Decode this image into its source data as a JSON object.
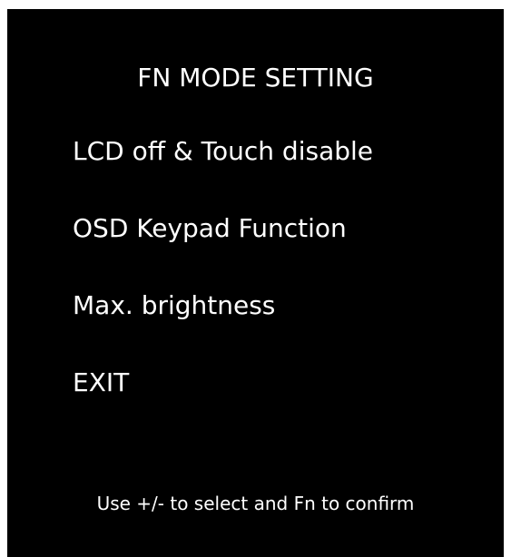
{
  "osd": {
    "title": "FN MODE SETTING",
    "menu_items": [
      {
        "label": "LCD off & Touch disable"
      },
      {
        "label": "OSD Keypad Function"
      },
      {
        "label": "Max. brightness"
      },
      {
        "label": "EXIT"
      }
    ],
    "hint": "Use +/- to select and Fn to confirm"
  },
  "colors": {
    "background": "#000000",
    "text": "#ffffff"
  }
}
